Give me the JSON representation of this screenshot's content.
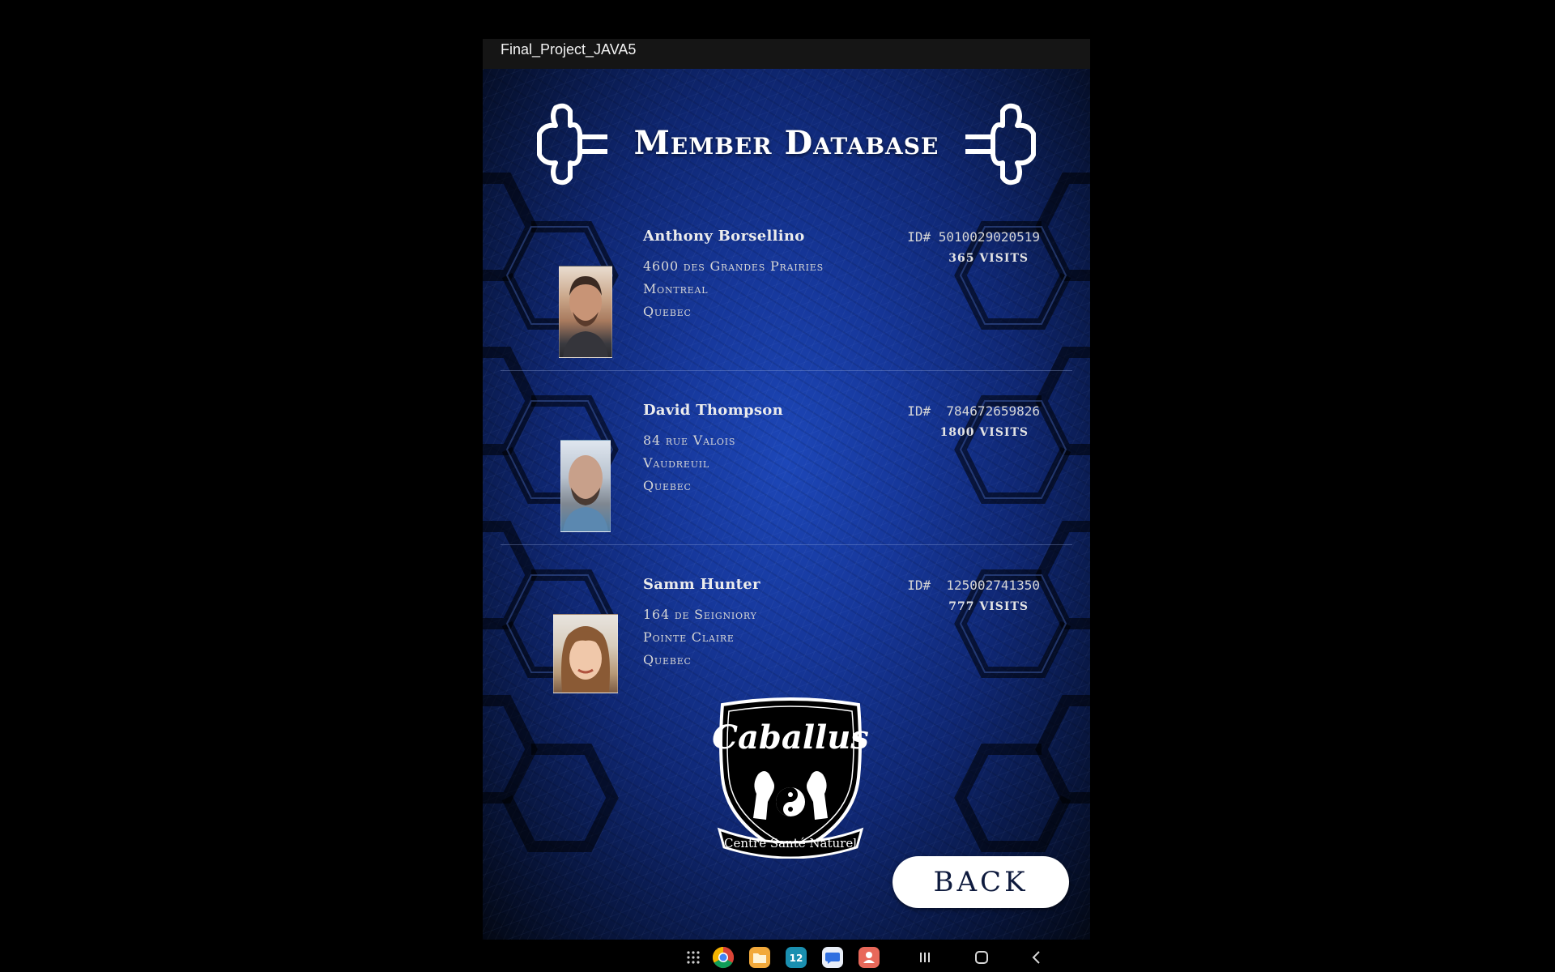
{
  "app": {
    "window_title": "Final_Project_JAVA5"
  },
  "header": {
    "title": "Member Database"
  },
  "members": [
    {
      "name": "Anthony Borsellino",
      "address_line1": "4600 des Grandes Prairies",
      "address_line2": "Montreal",
      "address_line3": "Quebec",
      "id": "ID# 5010029020519",
      "visits": "365 VISITS"
    },
    {
      "name": "David Thompson",
      "address_line1": "84 rue Valois",
      "address_line2": "Vaudreuil",
      "address_line3": "Quebec",
      "id": "ID#  784672659826",
      "visits": "1800 VISITS"
    },
    {
      "name": "Samm Hunter",
      "address_line1": "164 de Seigniory",
      "address_line2": "Pointe Claire",
      "address_line3": "Quebec",
      "id": "ID#  125002741350",
      "visits": "777 VISITS"
    }
  ],
  "logo": {
    "brand": "Caballus",
    "tagline": "Centre Santé Naturel"
  },
  "actions": {
    "back_label": "BACK"
  },
  "taskbar": {
    "icons": [
      "apps-grid-icon",
      "chrome-icon",
      "files-icon",
      "calendar-icon",
      "messages-icon",
      "contacts-icon"
    ],
    "calendar_day": "12",
    "nav": [
      "recents-icon",
      "home-icon",
      "back-nav-icon"
    ]
  },
  "colors": {
    "background": "#000000",
    "panel_blue": "#16379a",
    "button_bg": "#ffffff",
    "button_text": "#0e1a3d"
  }
}
